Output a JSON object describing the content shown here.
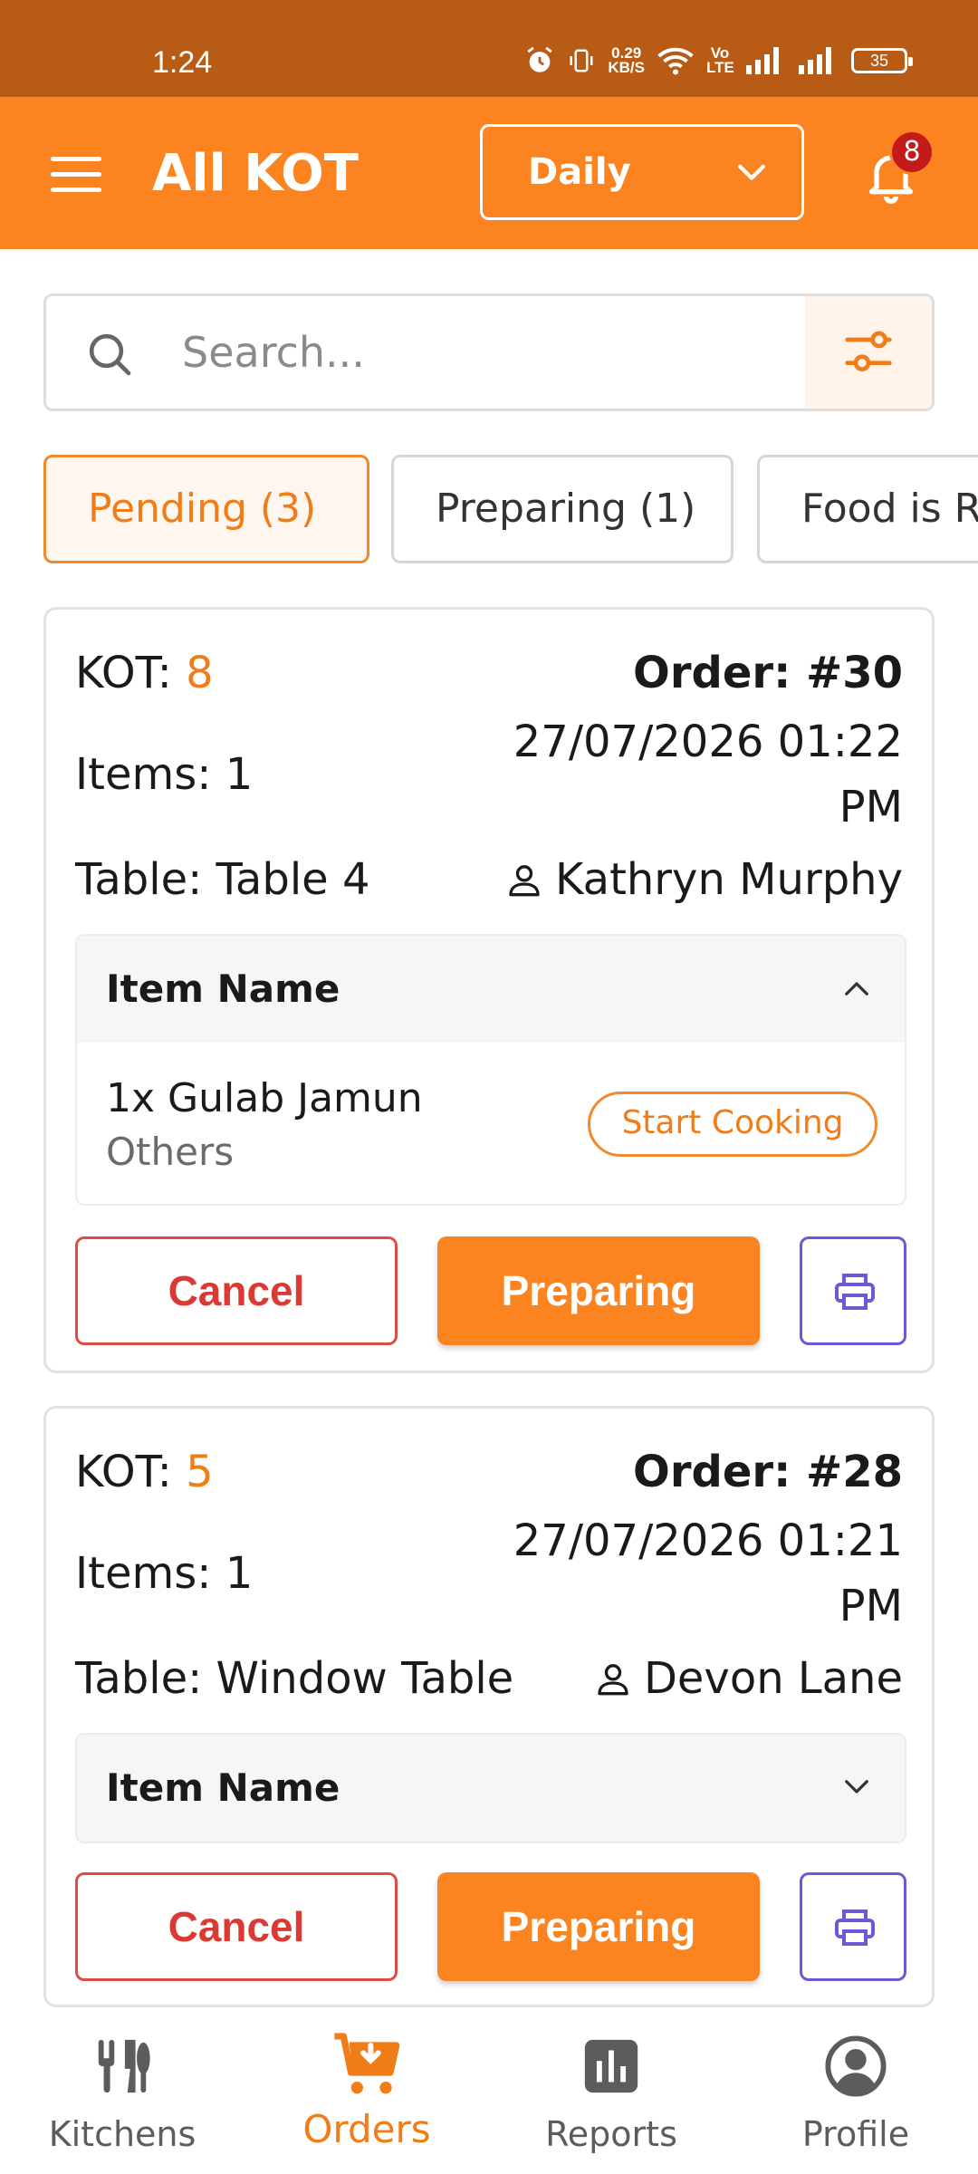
{
  "status_bar": {
    "time": "1:24",
    "net_speed_value": "0.29",
    "net_speed_unit": "KB/S",
    "volte": "Vo LTE",
    "battery": "35"
  },
  "app_bar": {
    "title": "All KOT",
    "range_selected": "Daily",
    "notification_count": "8"
  },
  "search": {
    "placeholder": "Search..."
  },
  "tabs": [
    {
      "label": "Pending (3)",
      "active": true
    },
    {
      "label": "Preparing (1)",
      "active": false
    },
    {
      "label": "Food is Ready",
      "active": false
    }
  ],
  "kots": [
    {
      "kot_label": "KOT:",
      "kot_number": "8",
      "order": "Order: #30",
      "datetime_line1": "27/07/2026 01:22",
      "datetime_line2": "PM",
      "items": "Items: 1",
      "table": "Table: Table 4",
      "customer": "Kathryn Murphy",
      "item_header": "Item Name",
      "expanded": true,
      "line_items": [
        {
          "name": "1x Gulab Jamun",
          "category": "Others",
          "action": "Start Cooking"
        }
      ],
      "cancel_label": "Cancel",
      "preparing_label": "Preparing"
    },
    {
      "kot_label": "KOT:",
      "kot_number": "5",
      "order": "Order: #28",
      "datetime_line1": "27/07/2026 01:21",
      "datetime_line2": "PM",
      "items": "Items: 1",
      "table": "Table: Window Table",
      "customer": "Devon Lane",
      "item_header": "Item Name",
      "expanded": false,
      "cancel_label": "Cancel",
      "preparing_label": "Preparing"
    }
  ],
  "bottom_nav": [
    {
      "label": "Kitchens",
      "icon": "kitchen-utensils-icon",
      "active": false
    },
    {
      "label": "Orders",
      "icon": "cart-icon",
      "active": true
    },
    {
      "label": "Reports",
      "icon": "bar-chart-icon",
      "active": false
    },
    {
      "label": "Profile",
      "icon": "user-circle-icon",
      "active": false
    }
  ],
  "colors": {
    "primary": "#fb8320",
    "status_bar": "#b85c15",
    "cancel": "#d93a33",
    "print": "#6a5ad6",
    "badge": "#c41a1a"
  }
}
